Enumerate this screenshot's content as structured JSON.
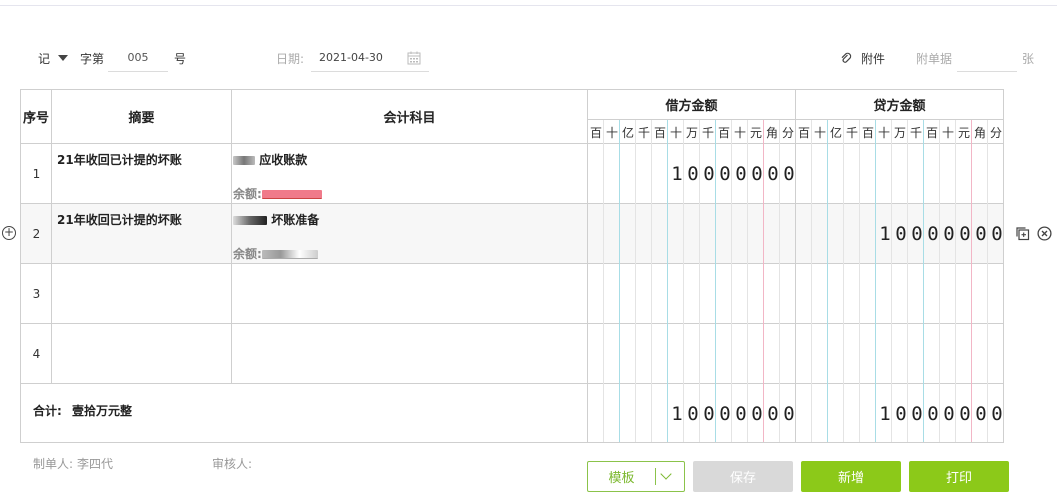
{
  "header": {
    "voucher_type": "记",
    "word_label": "字第",
    "voucher_number": "005",
    "number_suffix": "号",
    "date_label": "日期:",
    "date_value": "2021-04-30",
    "attachment_label": "附件",
    "attachment_docs_label": "附单据",
    "attachment_count": "",
    "attachment_unit": "张"
  },
  "table": {
    "col_seq": "序号",
    "col_summary": "摘要",
    "col_account": "会计科目",
    "col_debit": "借方金额",
    "col_credit": "贷方金额",
    "digit_units": [
      "百",
      "十",
      "亿",
      "千",
      "百",
      "十",
      "万",
      "千",
      "百",
      "十",
      "元",
      "角",
      "分"
    ],
    "rows": [
      {
        "seq": "1",
        "summary": "21年收回已计提的坏账",
        "account": "应收账款",
        "balance_label": "余额:",
        "debit": "10000000",
        "credit": ""
      },
      {
        "seq": "2",
        "summary": "21年收回已计提的坏账",
        "account": "坏账准备",
        "balance_label": "余额:",
        "debit": "",
        "credit": "10000000"
      },
      {
        "seq": "3",
        "summary": "",
        "account": "",
        "balance_label": "",
        "debit": "",
        "credit": ""
      },
      {
        "seq": "4",
        "summary": "",
        "account": "",
        "balance_label": "",
        "debit": "",
        "credit": ""
      }
    ],
    "total_label": "合计:",
    "total_words": "壹拾万元整",
    "total_debit": "10000000",
    "total_credit": "10000000"
  },
  "footer": {
    "preparer_label": "制单人:",
    "preparer_name": "李四代",
    "reviewer_label": "审核人:",
    "reviewer_name": "",
    "template_button": "模板",
    "save_button": "保存",
    "new_button": "新增",
    "print_button": "打印"
  },
  "colors": {
    "accent_green": "#8cc919",
    "disabled_gray": "#d9d9d9",
    "cyan_divider": "#a8dde6",
    "pink_divider": "#f2b6c6",
    "redacted_pink": "#f07a8a"
  },
  "icons": [
    "caret-down-icon",
    "calendar-icon",
    "paperclip-icon",
    "add-row-icon",
    "copy-row-icon",
    "delete-row-icon",
    "chevron-down-icon"
  ]
}
